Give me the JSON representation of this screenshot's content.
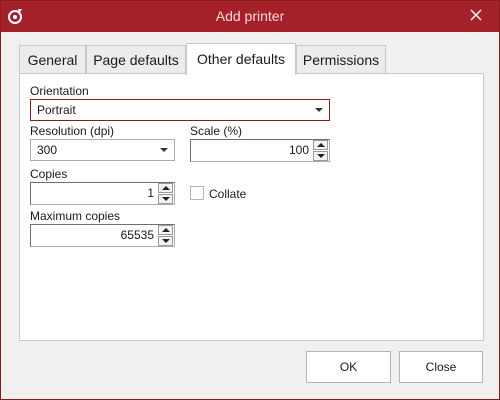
{
  "window": {
    "title": "Add printer",
    "accent_color": "#a5212a"
  },
  "tabs": [
    {
      "label": "General",
      "active": false
    },
    {
      "label": "Page defaults",
      "active": false
    },
    {
      "label": "Other defaults",
      "active": true
    },
    {
      "label": "Permissions",
      "active": false
    }
  ],
  "form": {
    "orientation": {
      "label": "Orientation",
      "value": "Portrait"
    },
    "resolution": {
      "label": "Resolution (dpi)",
      "value": "300"
    },
    "scale": {
      "label": "Scale (%)",
      "value": "100"
    },
    "copies": {
      "label": "Copies",
      "value": "1"
    },
    "collate": {
      "label": "Collate",
      "checked": false
    },
    "max_copies": {
      "label": "Maximum copies",
      "value": "65535"
    }
  },
  "buttons": {
    "ok": "OK",
    "close": "Close"
  },
  "icons": {
    "app": "app-logo-icon",
    "close": "close-icon",
    "dropdown": "chevron-down-icon",
    "spin_up": "spin-up-icon",
    "spin_down": "spin-down-icon"
  }
}
